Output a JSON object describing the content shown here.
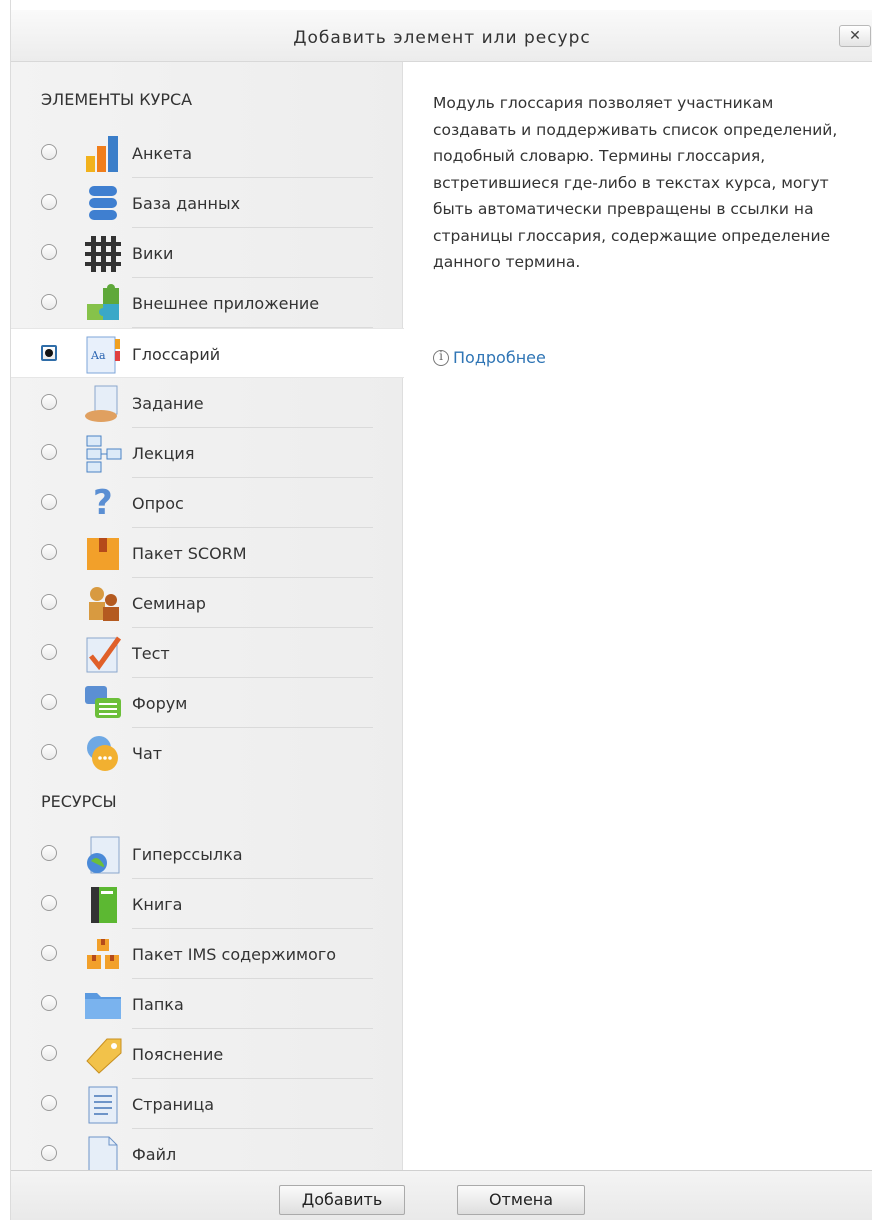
{
  "dialog": {
    "title": "Добавить элемент или ресурс",
    "close_label": "✕"
  },
  "activities": {
    "heading": "ЭЛЕМЕНТЫ КУРСА",
    "items": [
      {
        "label": "Анкета",
        "icon": "bar-chart-icon",
        "selected": false
      },
      {
        "label": "База данных",
        "icon": "database-icon",
        "selected": false
      },
      {
        "label": "Вики",
        "icon": "wiki-icon",
        "selected": false
      },
      {
        "label": "Внешнее приложение",
        "icon": "puzzle-icon",
        "selected": false
      },
      {
        "label": "Глоссарий",
        "icon": "glossary-icon",
        "selected": true
      },
      {
        "label": "Задание",
        "icon": "assignment-icon",
        "selected": false
      },
      {
        "label": "Лекция",
        "icon": "lesson-icon",
        "selected": false
      },
      {
        "label": "Опрос",
        "icon": "question-icon",
        "selected": false
      },
      {
        "label": "Пакет SCORM",
        "icon": "scorm-package-icon",
        "selected": false
      },
      {
        "label": "Семинар",
        "icon": "workshop-icon",
        "selected": false
      },
      {
        "label": "Тест",
        "icon": "quiz-check-icon",
        "selected": false
      },
      {
        "label": "Форум",
        "icon": "forum-icon",
        "selected": false
      },
      {
        "label": "Чат",
        "icon": "chat-icon",
        "selected": false
      }
    ]
  },
  "resources": {
    "heading": "РЕСУРСЫ",
    "items": [
      {
        "label": "Гиперссылка",
        "icon": "url-globe-icon",
        "selected": false
      },
      {
        "label": "Книга",
        "icon": "book-icon",
        "selected": false
      },
      {
        "label": "Пакет IMS содержимого",
        "icon": "ims-package-icon",
        "selected": false
      },
      {
        "label": "Папка",
        "icon": "folder-icon",
        "selected": false
      },
      {
        "label": "Пояснение",
        "icon": "label-tag-icon",
        "selected": false
      },
      {
        "label": "Страница",
        "icon": "page-icon",
        "selected": false
      },
      {
        "label": "Файл",
        "icon": "file-icon",
        "selected": false
      }
    ]
  },
  "summary": {
    "text": "Модуль глоссария позволяет участникам создавать и поддерживать список определений, подобный словарю. Термины глоссария, встретившиеся где-либо в текстах курса, могут быть автоматически превращены в ссылки на страницы глоссария, содержащие определение данного термина.",
    "more_link": "Подробнее"
  },
  "footer": {
    "add_label": "Добавить",
    "cancel_label": "Отмена"
  }
}
